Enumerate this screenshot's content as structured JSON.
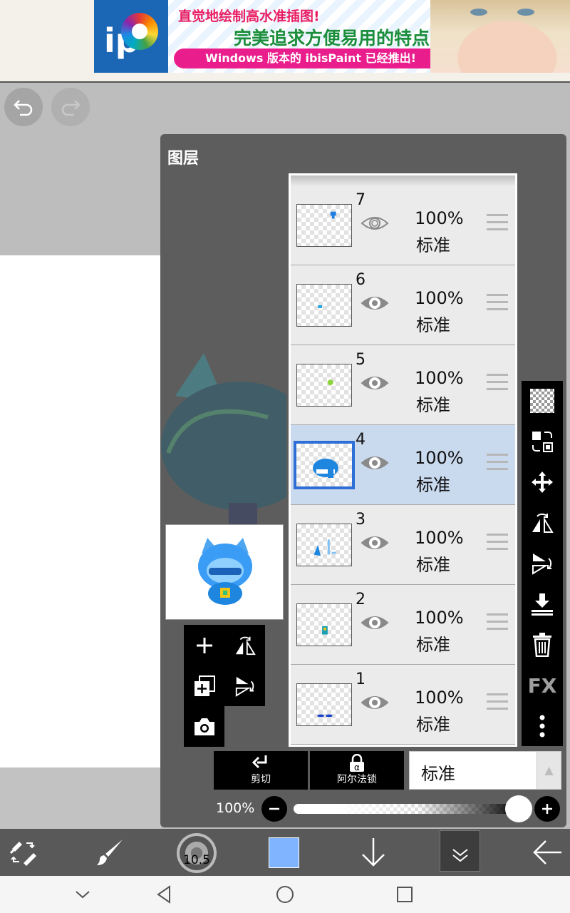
{
  "ad": {
    "line1": "直觉地绘制高水准插图!",
    "line2": "完美追求方便易用的特点!",
    "line3": "Windows 版本的 ibisPaint 已经推出!",
    "logo_text": "ip"
  },
  "panel": {
    "title": "图层"
  },
  "layers": [
    {
      "number": "7",
      "opacity": "100%",
      "blend": "标准",
      "selected": false
    },
    {
      "number": "6",
      "opacity": "100%",
      "blend": "标准",
      "selected": false
    },
    {
      "number": "5",
      "opacity": "100%",
      "blend": "标准",
      "selected": false
    },
    {
      "number": "4",
      "opacity": "100%",
      "blend": "标准",
      "selected": true
    },
    {
      "number": "3",
      "opacity": "100%",
      "blend": "标准",
      "selected": false
    },
    {
      "number": "2",
      "opacity": "100%",
      "blend": "标准",
      "selected": false
    },
    {
      "number": "1",
      "opacity": "100%",
      "blend": "标准",
      "selected": false
    }
  ],
  "controls": {
    "clip_label": "剪切",
    "alpha_lock_label": "阿尔法锁",
    "blend_mode": "标准",
    "opacity_label": "100%",
    "opacity_value": 1.0
  },
  "toolbar": {
    "brush_size": "10.5",
    "current_color": "#80b4ff"
  },
  "colors": {
    "selected_layer_bg": "#c9d9ee",
    "selected_border": "#2d6fd6",
    "panel_bg": "#5d5d5d"
  }
}
